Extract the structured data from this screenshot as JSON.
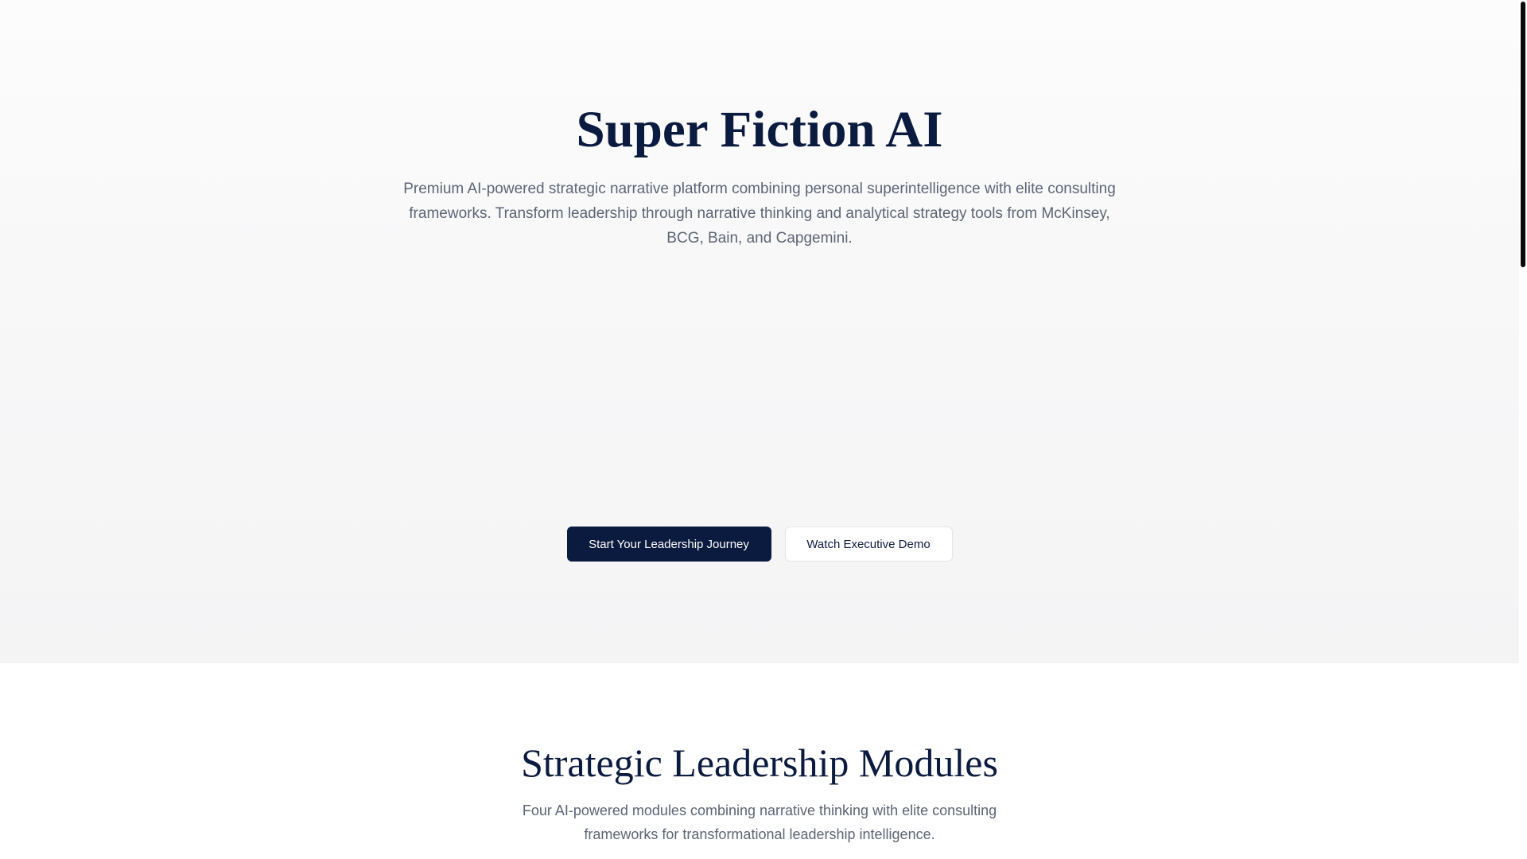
{
  "hero": {
    "title": "Super Fiction AI",
    "subtitle": "Premium AI-powered strategic narrative platform combining personal superintelligence with elite consulting frameworks. Transform leadership through narrative thinking and analytical strategy tools from McKinsey, BCG, Bain, and Capgemini.",
    "primary_cta": "Start Your Leadership Journey",
    "secondary_cta": "Watch Executive Demo"
  },
  "modules": {
    "title": "Strategic Leadership Modules",
    "subtitle": "Four AI-powered modules combining narrative thinking with elite consulting frameworks for transformational leadership intelligence."
  },
  "colors": {
    "brand_navy": "#0b1a3f",
    "muted_text": "#5d6474",
    "hero_background": "#f6f6f7"
  }
}
